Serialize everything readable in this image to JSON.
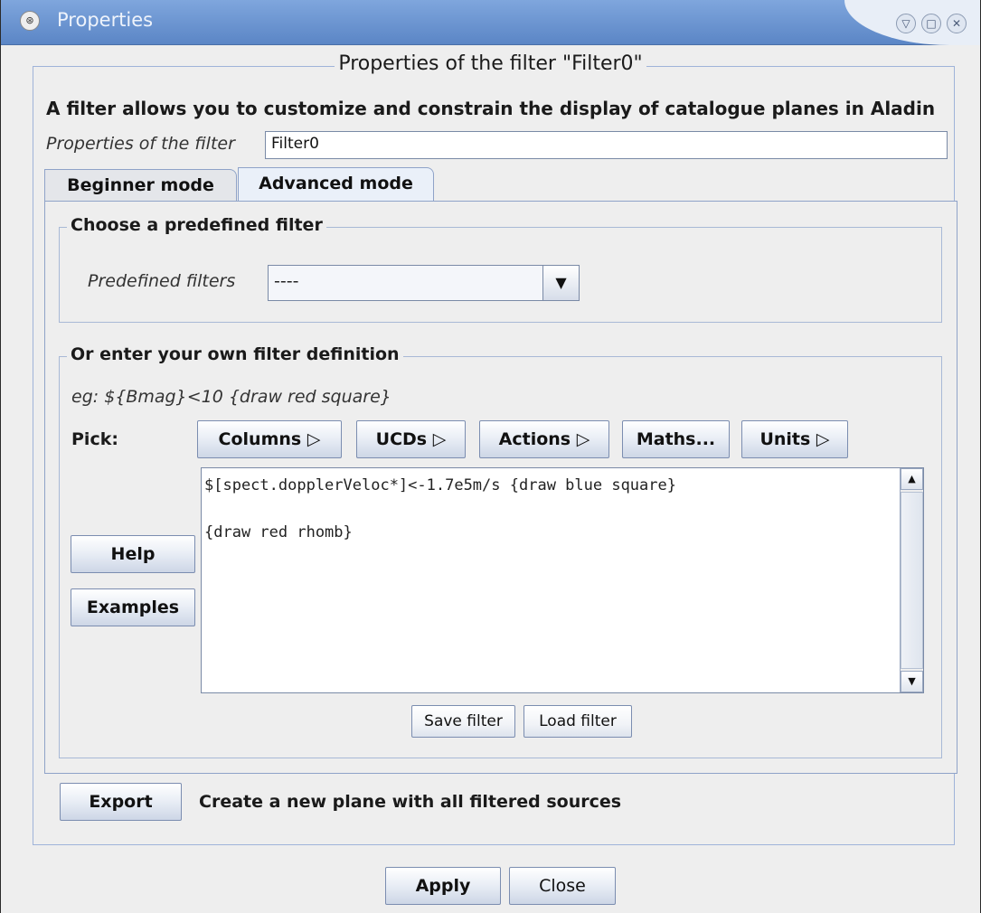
{
  "window": {
    "title": "Properties",
    "icons": [
      "app-icon",
      "minimize-icon",
      "maximize-icon",
      "close-icon"
    ]
  },
  "header": {
    "section_title": "Properties of the filter \"Filter0\"",
    "description": "A filter allows you to customize and constrain the display of catalogue planes in Aladin",
    "name_label": "Properties of the filter",
    "name_value": "Filter0"
  },
  "tabs": [
    {
      "label": "Beginner mode",
      "active": false
    },
    {
      "label": "Advanced mode",
      "active": true
    }
  ],
  "predefined": {
    "group_title": "Choose a predefined filter",
    "label": "Predefined filters",
    "selected": "----"
  },
  "custom": {
    "group_title": "Or enter your own filter definition",
    "example": "eg: ${Bmag}<10 {draw red square}",
    "pick_label": "Pick:",
    "pick_buttons": [
      "Columns ▷",
      "UCDs ▷",
      "Actions ▷",
      "Maths...",
      "Units ▷"
    ],
    "help_label": "Help",
    "examples_label": "Examples",
    "definition": "$[spect.dopplerVeloc*]<-1.7e5m/s {draw blue square}\n\n{draw red rhomb}",
    "save_label": "Save filter",
    "load_label": "Load filter"
  },
  "export": {
    "button_label": "Export",
    "text": "Create a new plane with all filtered sources"
  },
  "footer": {
    "apply_label": "Apply",
    "close_label": "Close"
  }
}
